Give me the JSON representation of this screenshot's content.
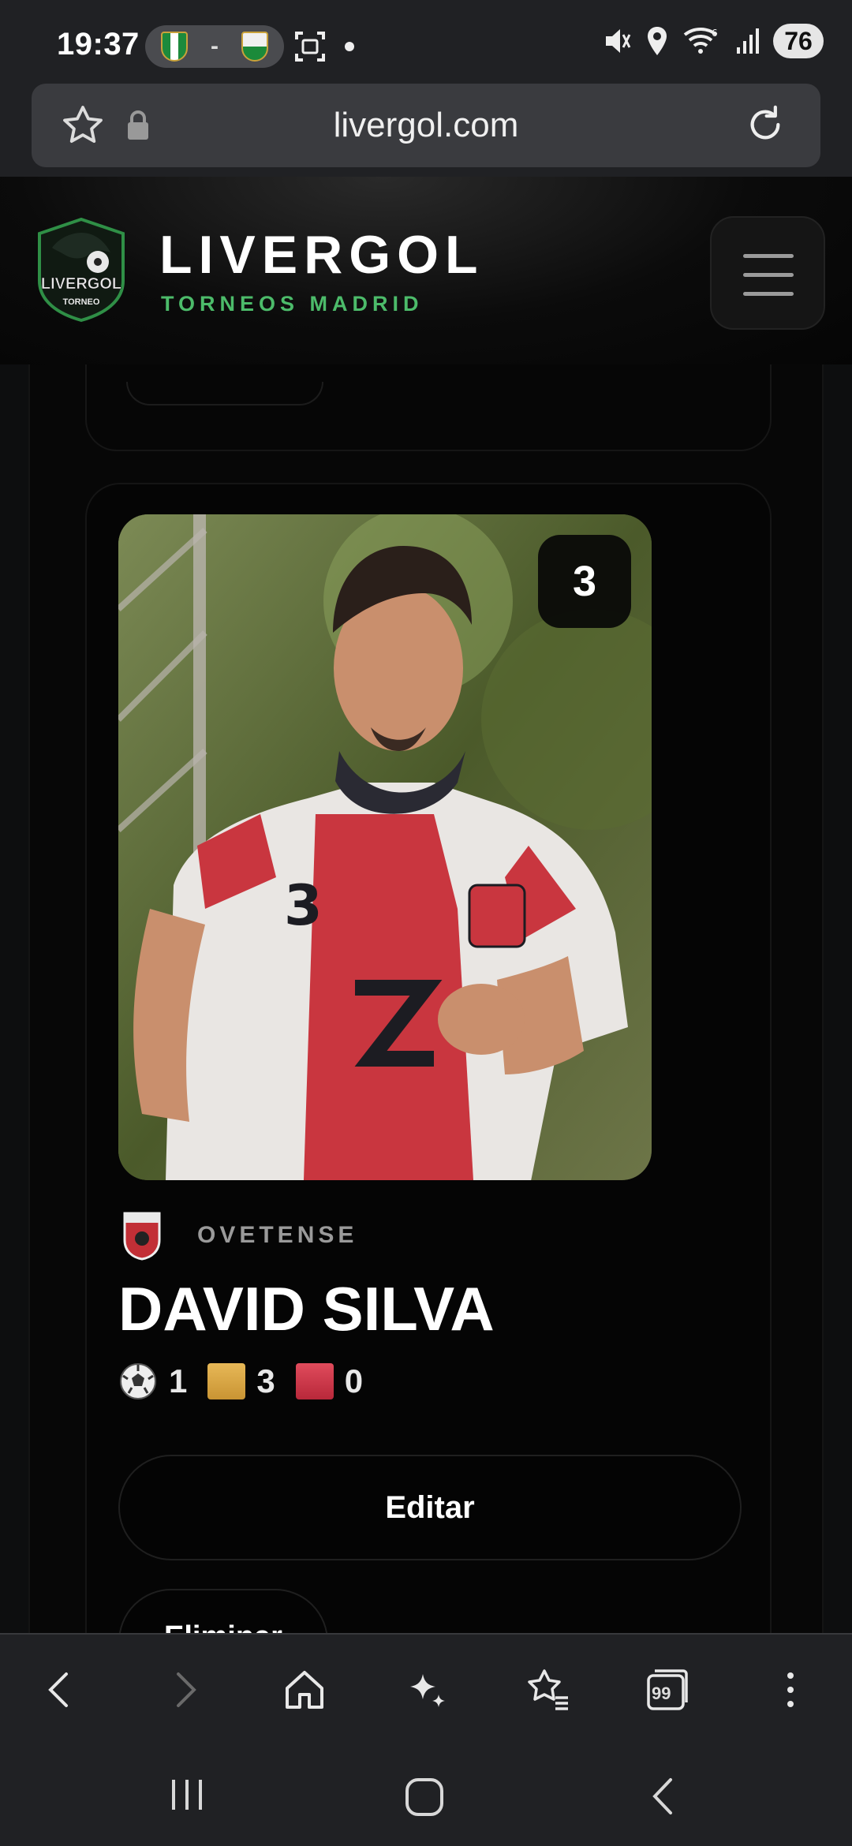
{
  "status_bar": {
    "time": "19:37",
    "match_score": "-",
    "battery": "76"
  },
  "browser": {
    "url": "livergol.com",
    "tab_count": "99"
  },
  "site": {
    "brand_title": "LIVERGOL",
    "brand_subtitle": "TORNEOS MADRID",
    "logo_text_top": "LIVERGOL",
    "logo_text_bottom": "TORNEO"
  },
  "player": {
    "number": "3",
    "team": "OVETENSE",
    "name": "DAVID SILVA",
    "goals": "1",
    "yellow_cards": "3",
    "red_cards": "0"
  },
  "actions": {
    "edit_label": "Editar",
    "delete_label": "Eliminar"
  },
  "colors": {
    "accent_green": "#4cbb6a",
    "yellow_card": "#d9a846",
    "red_card": "#d03a4b",
    "background": "#070707"
  },
  "icons": {
    "status": [
      "betis-crest-icon",
      "elche-crest-icon",
      "screenshot-icon",
      "mute-icon",
      "location-icon",
      "wifi-icon",
      "signal-icon"
    ],
    "browser_nav": [
      "back-icon",
      "forward-icon",
      "home-icon",
      "sparkle-icon",
      "bookmarks-icon",
      "tabs-icon",
      "more-icon"
    ],
    "system_nav": [
      "recents-icon",
      "home-circle-icon",
      "system-back-icon"
    ]
  }
}
